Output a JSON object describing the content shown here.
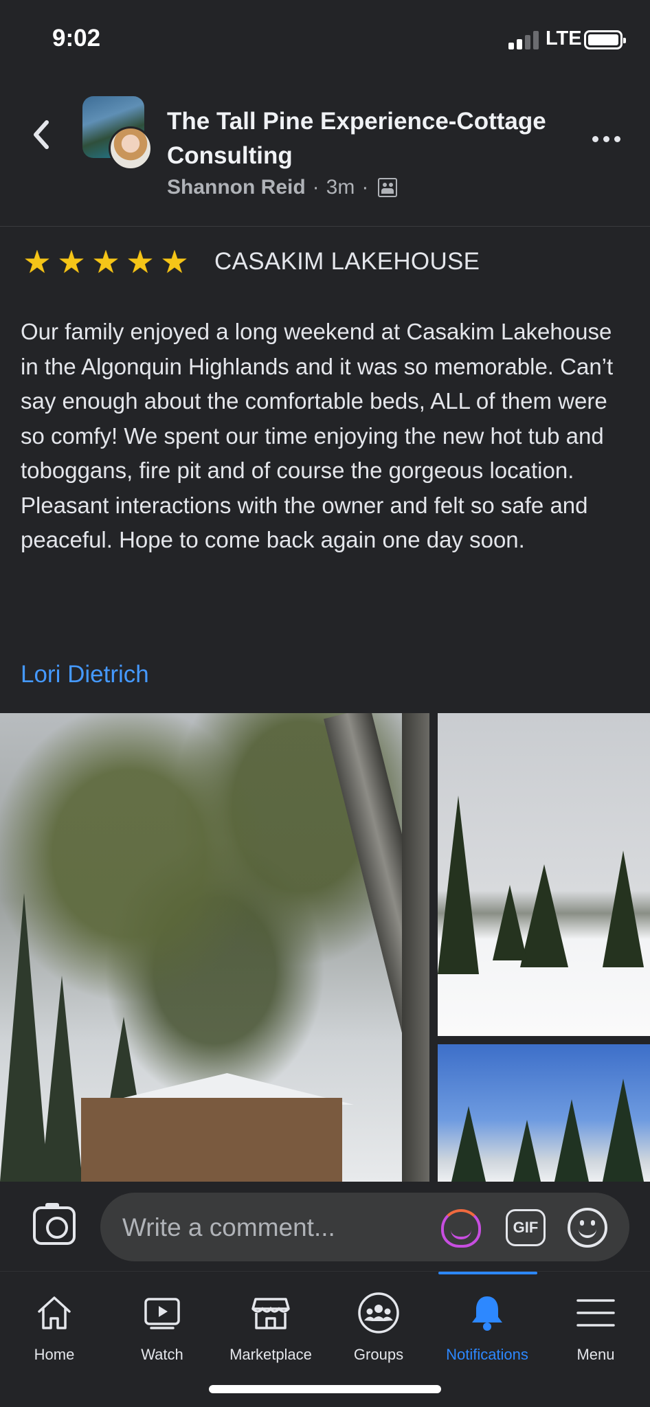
{
  "status_bar": {
    "time": "9:02",
    "network": "LTE"
  },
  "header": {
    "page_title": "The Tall Pine Experience-Cottage Consulting",
    "author": "Shannon Reid",
    "separator": "·",
    "timestamp": "3m",
    "back_icon": "chevron-left-icon",
    "more_icon": "more-horizontal-icon",
    "privacy_icon": "group-members-icon"
  },
  "post": {
    "rating_stars": 5,
    "star_glyph": "★",
    "place": "CASAKIM LAKEHOUSE",
    "review_text": "Our family enjoyed a long weekend at Casakim Lakehouse in the Algonquin Highlands and it was so memorable. Can’t say enough about the comfortable beds, ALL of them were so comfy! We spent our time enjoying the new hot tub and toboggans, fire pit and of course the gorgeous location. Pleasant interactions with the owner and felt so safe and peaceful. Hope to come back again one day soon.",
    "reviewer": "Lori Dietrich",
    "photos": [
      "snowy-pine-tree-cottage-photo",
      "snowy-lake-yard-photo",
      "blue-sky-pines-photo"
    ]
  },
  "comment_bar": {
    "placeholder": "Write a comment...",
    "gif_label": "GIF",
    "icons": [
      "camera-icon",
      "avatar-sticker-icon",
      "gif-icon",
      "emoji-icon"
    ]
  },
  "tabs": [
    {
      "label": "Home",
      "icon": "home-icon",
      "active": false
    },
    {
      "label": "Watch",
      "icon": "watch-icon",
      "active": false
    },
    {
      "label": "Marketplace",
      "icon": "marketplace-icon",
      "active": false
    },
    {
      "label": "Groups",
      "icon": "groups-icon",
      "active": false
    },
    {
      "label": "Notifications",
      "icon": "bell-icon",
      "active": true
    },
    {
      "label": "Menu",
      "icon": "menu-icon",
      "active": false
    }
  ],
  "colors": {
    "background": "#232427",
    "link": "#4599ff",
    "active_tab": "#2d88ff",
    "star": "#f5c518"
  }
}
